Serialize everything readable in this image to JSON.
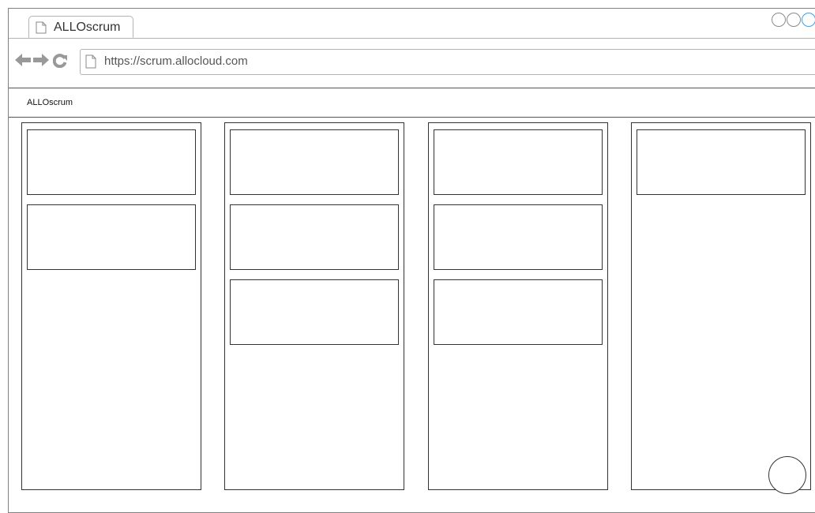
{
  "browser": {
    "tab": {
      "title": "ALLOscrum",
      "icon": "page-icon"
    },
    "window_controls": [
      "minimize-circle",
      "maximize-circle",
      "close-circle"
    ],
    "nav": {
      "back_icon": "back-arrow-icon",
      "forward_icon": "forward-arrow-icon",
      "reload_icon": "reload-icon"
    },
    "address": {
      "url": "https://scrum.allocloud.com",
      "icon": "page-icon"
    }
  },
  "app": {
    "title": "ALLOscrum"
  },
  "board": {
    "columns": [
      {
        "cards": 2
      },
      {
        "cards": 3
      },
      {
        "cards": 3
      },
      {
        "cards": 1
      }
    ]
  },
  "fab": {
    "icon": "circle-button"
  },
  "colors": {
    "accent": "#3aa0e8",
    "border": "#333333",
    "chrome_gray": "#999999"
  }
}
